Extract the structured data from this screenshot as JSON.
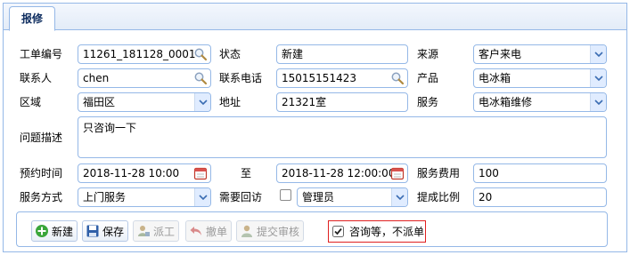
{
  "tab": {
    "label": "报修"
  },
  "form": {
    "order_no": {
      "label": "工单编号",
      "value": "11261_181128_0001"
    },
    "status": {
      "label": "状态",
      "value": "新建"
    },
    "source": {
      "label": "来源",
      "value": "客户来电"
    },
    "contact": {
      "label": "联系人",
      "value": "chen"
    },
    "phone": {
      "label": "联系电话",
      "value": "15015151423"
    },
    "product": {
      "label": "产品",
      "value": "电冰箱"
    },
    "region": {
      "label": "区域",
      "value": "福田区"
    },
    "address": {
      "label": "地址",
      "value": "21321室"
    },
    "service": {
      "label": "服务",
      "value": "电冰箱维修"
    },
    "problem": {
      "label": "问题描述",
      "value": "只咨询一下"
    },
    "appt_time": {
      "label": "预约时间",
      "start": "2018-11-28 10:00",
      "to_label": "至",
      "end": "2018-11-28 12:00:00"
    },
    "fee": {
      "label": "服务费用",
      "value": "100"
    },
    "service_mode": {
      "label": "服务方式",
      "value": "上门服务"
    },
    "callback": {
      "label": "需要回访",
      "checked": false,
      "operator": "管理员"
    },
    "commission": {
      "label": "提成比例",
      "value": "20"
    }
  },
  "toolbar": {
    "new_label": "新建",
    "save_label": "保存",
    "dispatch_label": "派工",
    "withdraw_label": "撤单",
    "submit_label": "提交审核",
    "consult_label": "咨询等，不派单",
    "consult_checked": true
  },
  "colors": {
    "border": "#95b8e7",
    "highlight_border": "#e02020"
  }
}
